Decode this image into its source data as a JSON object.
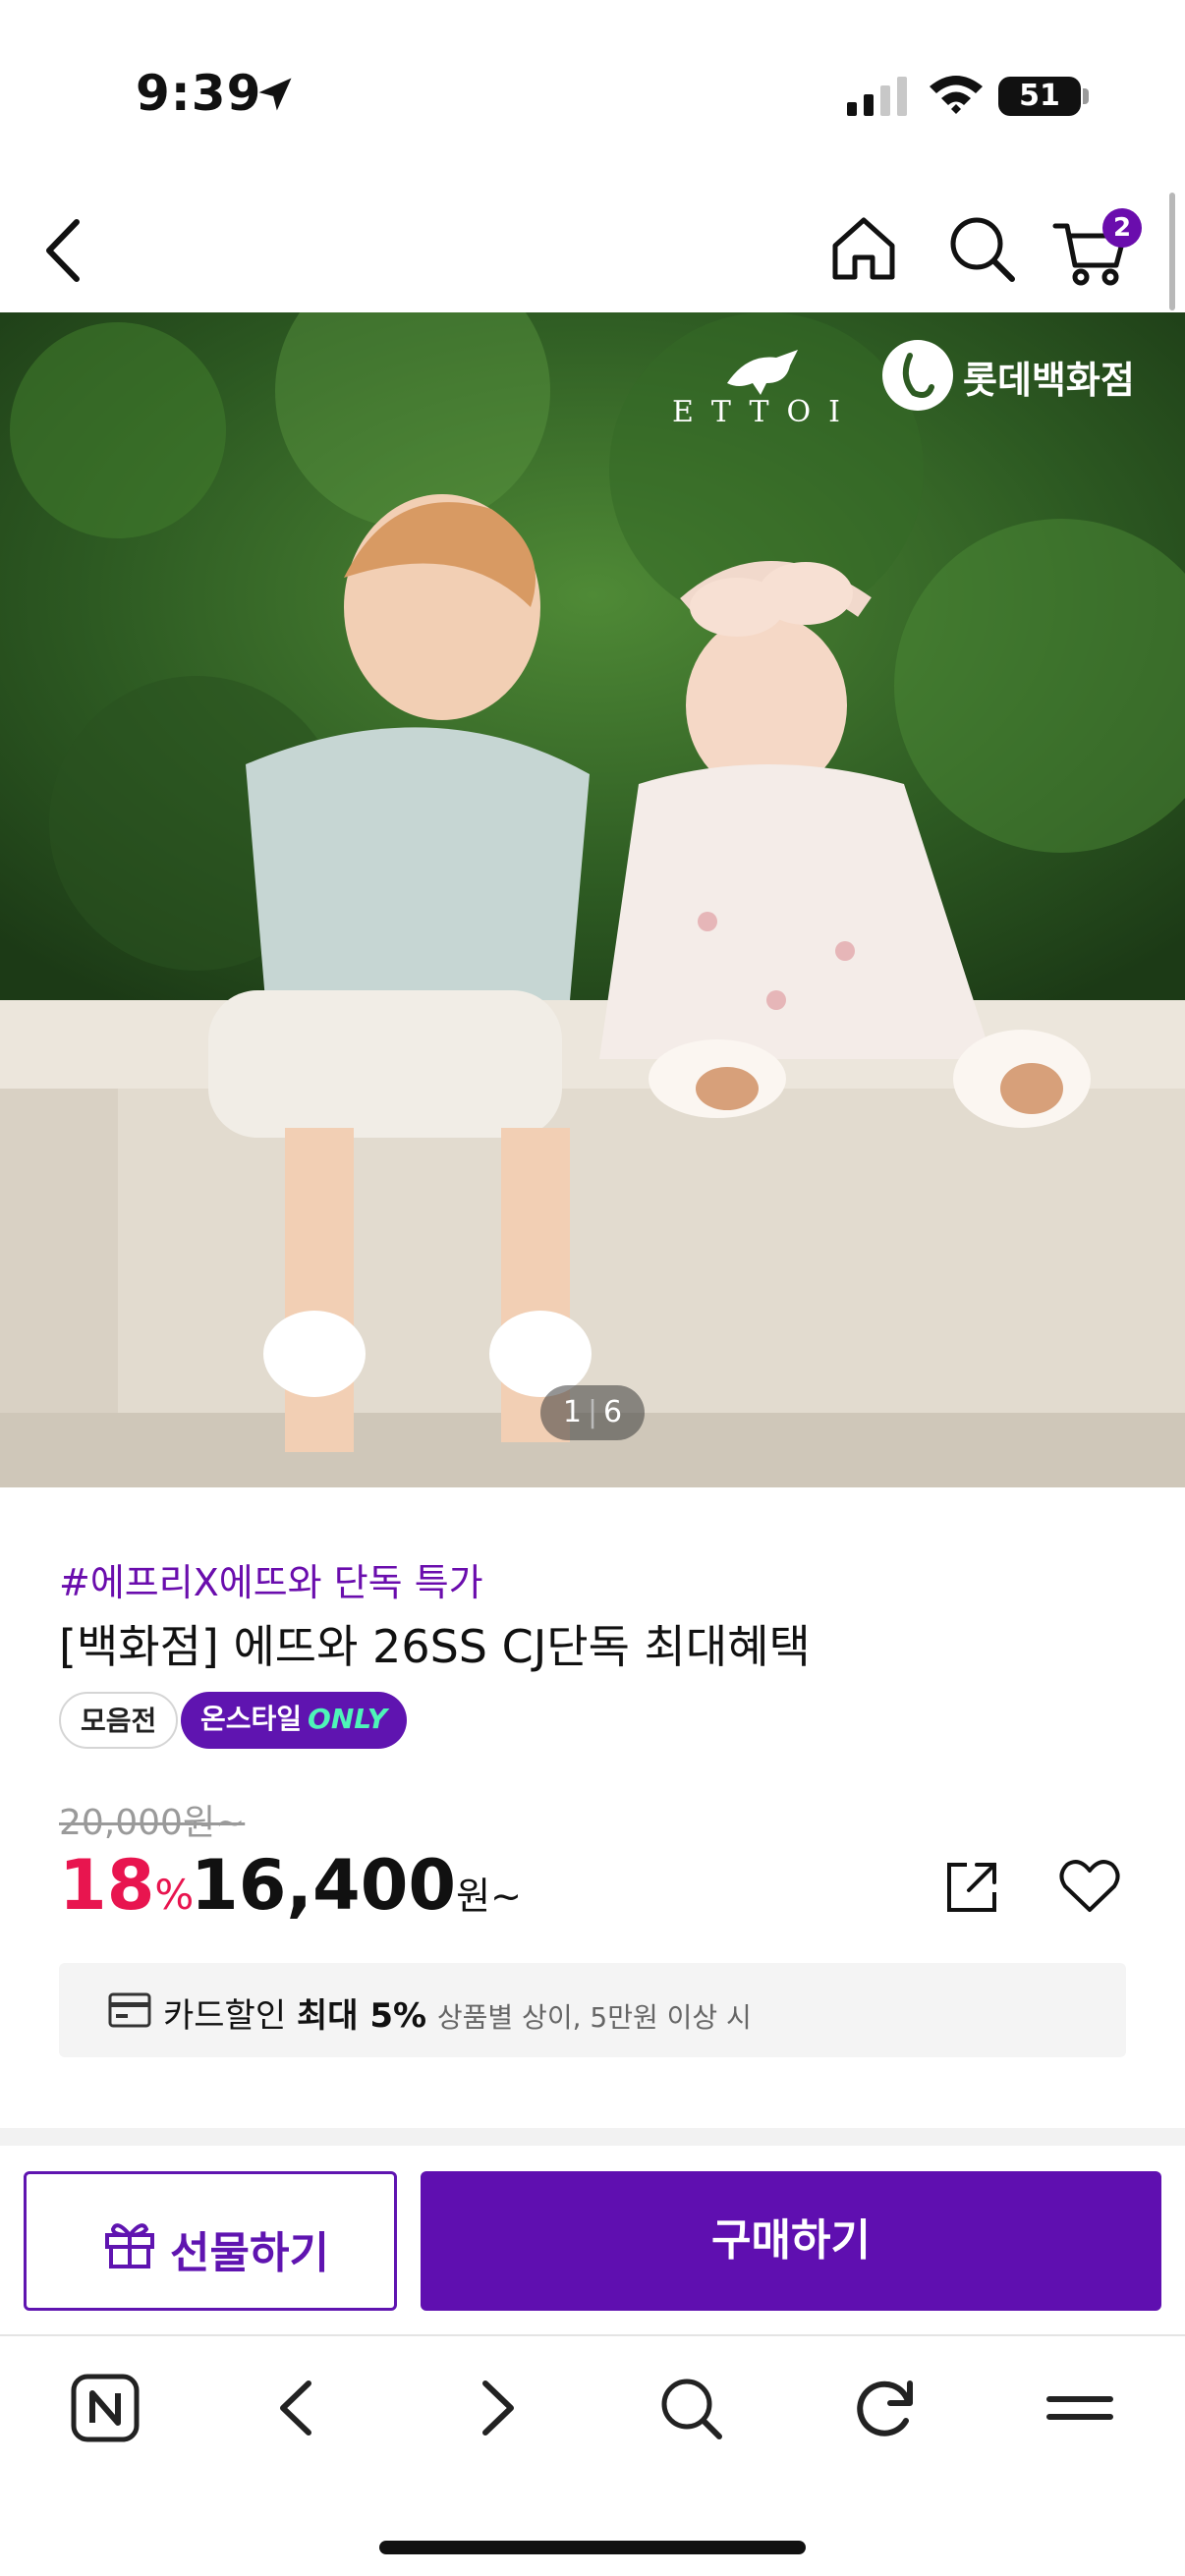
{
  "status_bar": {
    "time": "9:39",
    "battery": "51",
    "icons": [
      "location-arrow-icon",
      "signal-bars-icon",
      "wifi-icon",
      "battery-icon"
    ]
  },
  "nav": {
    "back_icon": "chevron-left-icon",
    "home_icon": "home-icon",
    "search_icon": "search-icon",
    "cart_icon": "cart-icon",
    "cart_count": "2"
  },
  "hero": {
    "brand_ettoi": "ETTOI",
    "brand_lotte": "롯데백화점",
    "page_current": "1",
    "page_total": "6"
  },
  "product": {
    "promo_tag": "#에프리X에뜨와 단독 특가",
    "title": "[백화점] 에뜨와 26SS CJ단독 최대혜택",
    "chips": {
      "collection": "모음전",
      "onstyle": "온스타일",
      "only": "ONLY"
    },
    "original_price": "20,000원~",
    "discount_value": "18",
    "discount_unit": "%",
    "price_value": "16,400",
    "price_unit": "원~",
    "card_benefit": {
      "label": "카드할인",
      "highlight": "최대 5%",
      "note": "상품별 상이, 5만원 이상 시"
    }
  },
  "actions": {
    "gift_label": "선물하기",
    "buy_label": "구매하기"
  },
  "browser_toolbar": {
    "icons": [
      "naver-n-icon",
      "back-arrow-icon",
      "forward-arrow-icon",
      "search-icon",
      "refresh-icon",
      "menu-icon"
    ]
  },
  "colors": {
    "brand_purple": "#5f0fb0",
    "discount_red": "#e8154f",
    "badge_purple": "#6a0dad",
    "only_green": "#4ef5b8"
  }
}
